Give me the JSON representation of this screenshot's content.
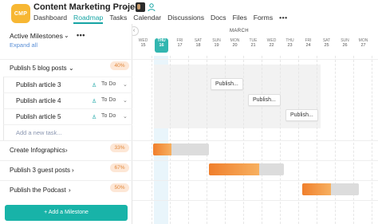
{
  "header": {
    "logo": "CMP",
    "project_title": "Content Marketing Project",
    "nav": [
      "Dashboard",
      "Roadmap",
      "Tasks",
      "Calendar",
      "Discussions",
      "Docs",
      "Files",
      "Forms"
    ],
    "active_tab": "Roadmap",
    "more": "•••"
  },
  "milestones_panel": {
    "title": "Active Milestones",
    "expand_all": "Expand all",
    "menu": "•••",
    "milestones": [
      {
        "label": "Publish 5 blog posts",
        "progress": "40%",
        "tasks": [
          {
            "label": "Publish article 3",
            "status": "To Do"
          },
          {
            "label": "Publish article 4",
            "status": "To Do"
          },
          {
            "label": "Publish article 5",
            "status": "To Do"
          }
        ],
        "add_task": "Add a new task..."
      },
      {
        "label": "Create Infographics",
        "progress": "33%"
      },
      {
        "label": "Publish 3 guest posts",
        "progress": "67%"
      },
      {
        "label": "Publish the Podcast",
        "progress": "50%"
      }
    ],
    "add_button": "+ Add a Milestone"
  },
  "timeline": {
    "month": "MARCH",
    "days": [
      {
        "name": "WED",
        "num": "15"
      },
      {
        "name": "THU",
        "num": "16",
        "today": true
      },
      {
        "name": "FRI",
        "num": "17"
      },
      {
        "name": "SAT",
        "num": "18"
      },
      {
        "name": "SUN",
        "num": "19"
      },
      {
        "name": "MON",
        "num": "20"
      },
      {
        "name": "TUE",
        "num": "21"
      },
      {
        "name": "WED",
        "num": "22"
      },
      {
        "name": "THU",
        "num": "23"
      },
      {
        "name": "FRI",
        "num": "24"
      },
      {
        "name": "SAT",
        "num": "25"
      },
      {
        "name": "SUN",
        "num": "26"
      },
      {
        "name": "MON",
        "num": "27"
      }
    ],
    "task_chips": [
      "Publish...",
      "Publish...",
      "Publish..."
    ],
    "bar_progress": [
      0.33,
      0.67,
      0.5
    ],
    "colors": {
      "accent": "#16a4a4",
      "today": "#32b6b0",
      "bar_fill": "#f07f2c",
      "bar_track": "#dcdcdc",
      "button": "#18b3a8"
    }
  }
}
